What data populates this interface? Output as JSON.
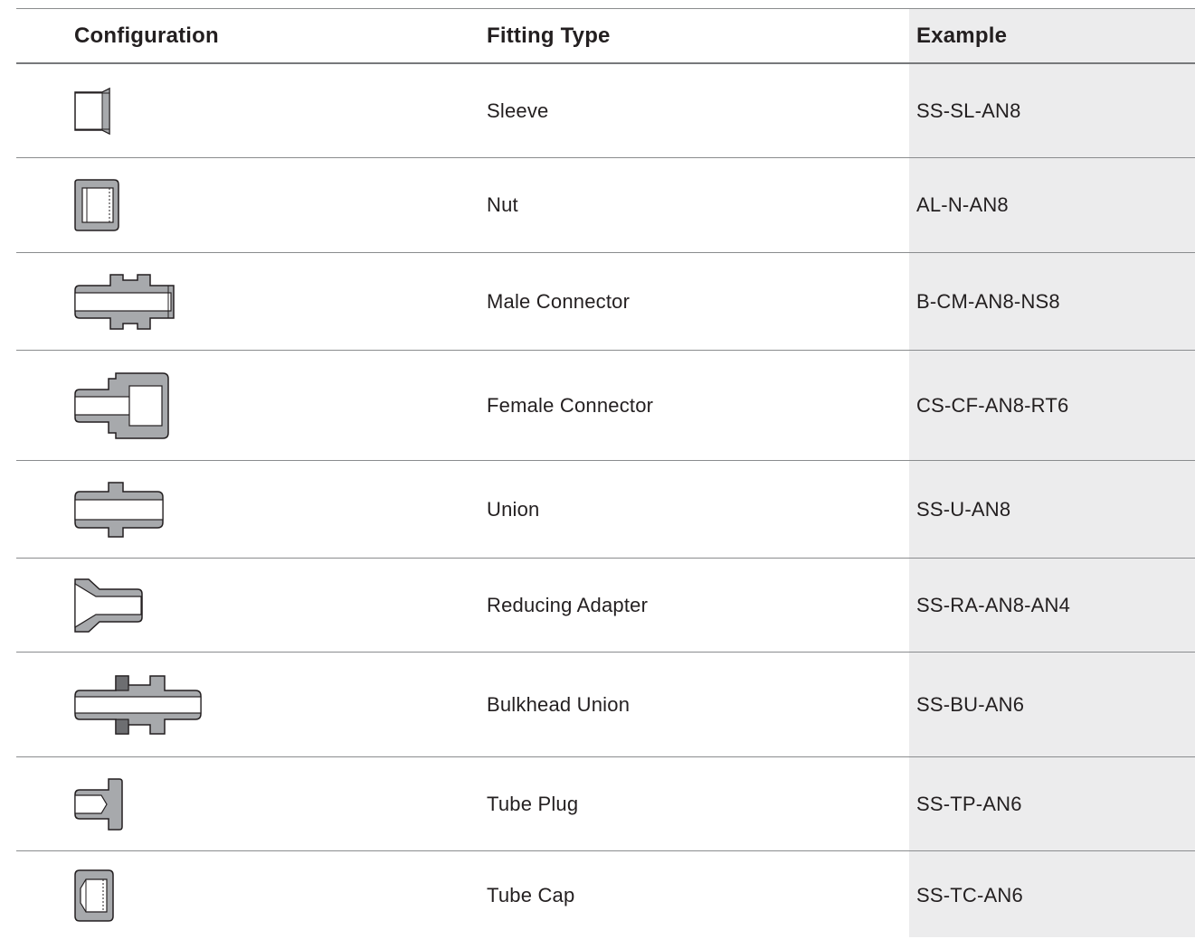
{
  "table": {
    "headers": {
      "configuration": "Configuration",
      "fitting_type": "Fitting Type",
      "example": "Example"
    },
    "rows": [
      {
        "icon": "sleeve-icon",
        "fitting_type": "Sleeve",
        "example": "SS-SL-AN8"
      },
      {
        "icon": "nut-icon",
        "fitting_type": "Nut",
        "example": "AL-N-AN8"
      },
      {
        "icon": "male-connector-icon",
        "fitting_type": "Male Connector",
        "example": "B-CM-AN8-NS8"
      },
      {
        "icon": "female-connector-icon",
        "fitting_type": "Female Connector",
        "example": "CS-CF-AN8-RT6"
      },
      {
        "icon": "union-icon",
        "fitting_type": "Union",
        "example": "SS-U-AN8"
      },
      {
        "icon": "reducing-adapter-icon",
        "fitting_type": "Reducing Adapter",
        "example": "SS-RA-AN8-AN4"
      },
      {
        "icon": "bulkhead-union-icon",
        "fitting_type": "Bulkhead Union",
        "example": "SS-BU-AN6"
      },
      {
        "icon": "tube-plug-icon",
        "fitting_type": "Tube Plug",
        "example": "SS-TP-AN6"
      },
      {
        "icon": "tube-cap-icon",
        "fitting_type": "Tube Cap",
        "example": "SS-TC-AN6"
      }
    ]
  },
  "colors": {
    "metal_fill": "#a7a9ac",
    "outline": "#231f20",
    "shade": "#ececed",
    "rule": "#8a8c8e",
    "nut_dark": "#6d6e71"
  }
}
